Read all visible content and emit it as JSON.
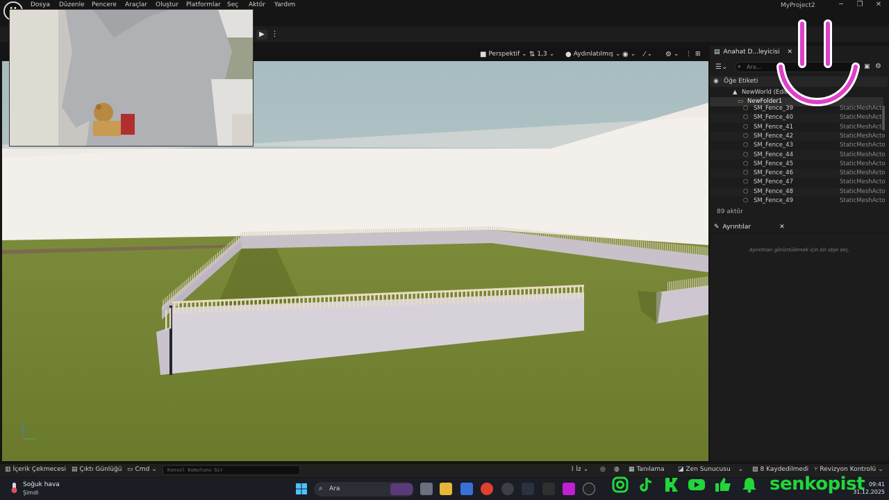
{
  "menu": {
    "items": [
      "Dosya",
      "Düzenle",
      "Pencere",
      "Araçlar",
      "Oluştur",
      "Platformlar",
      "Seç",
      "Aktör",
      "Yardım"
    ],
    "project_title": "MyProject2"
  },
  "viewport": {
    "camera_mode": "Perspektif",
    "camera_speed": "1,3",
    "lighting_mode": "Aydınlatılmış"
  },
  "outliner": {
    "tab_title": "Anahat D...leyicisi",
    "search_placeholder": "Ara...",
    "column_label": "Öğe Etiketi",
    "world": "NewWorld (Edito",
    "folder": "NewFolder1",
    "rows": [
      {
        "name": "SM_Fence_39",
        "type": "StaticMeshActo"
      },
      {
        "name": "SM_Fence_40",
        "type": "StaticMeshActo"
      },
      {
        "name": "SM_Fence_41",
        "type": "StaticMeshActo"
      },
      {
        "name": "SM_Fence_42",
        "type": "StaticMeshActo"
      },
      {
        "name": "SM_Fence_43",
        "type": "StaticMeshActo"
      },
      {
        "name": "SM_Fence_44",
        "type": "StaticMeshActo"
      },
      {
        "name": "SM_Fence_45",
        "type": "StaticMeshActo"
      },
      {
        "name": "SM_Fence_46",
        "type": "StaticMeshActo"
      },
      {
        "name": "SM_Fence_47",
        "type": "StaticMeshActo"
      },
      {
        "name": "SM_Fence_48",
        "type": "StaticMeshActo"
      },
      {
        "name": "SM_Fence_49",
        "type": "StaticMeshActo"
      }
    ],
    "actor_count": "89 aktör"
  },
  "details": {
    "tab_title": "Ayrıntılar",
    "empty_message": "Ayrıntıları görüntülemek için bir obje seç."
  },
  "bottombar": {
    "content_drawer": "İçerik Çekmecesi",
    "output_log": "Çıktı Günlüğü",
    "cmd": "Cmd",
    "console_placeholder": "Konsol Komutunu Gir",
    "trace": "İz",
    "derived_data": "Tanılama",
    "zen": "Zen Sunucusu",
    "unsaved": "8 Kaydedilmedi",
    "revision": "Revizyon Kontrolü"
  },
  "taskbar": {
    "weather_title": "Soğuk hava",
    "weather_sub": "Şimdi",
    "search_label": "Ara",
    "time": "09:41",
    "date": "31.12.2025"
  },
  "overlay": {
    "brand": "senkopist"
  },
  "colors": {
    "grass": "#6f7f2f",
    "sky": "#a9bfc2",
    "wall": "#c4bdc6",
    "brand_green": "#22d63a",
    "smiley": "#e040c8"
  }
}
